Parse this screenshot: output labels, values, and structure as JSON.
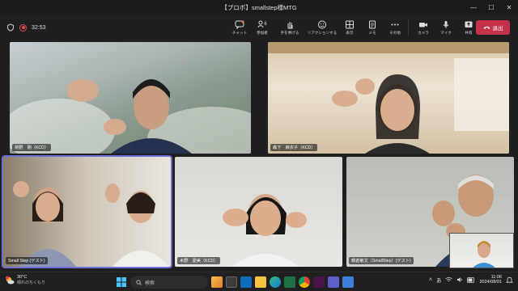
{
  "window": {
    "title": "【プロボ】smallstep様MTG",
    "controls": [
      "minimize",
      "maximize",
      "close"
    ]
  },
  "toolbar": {
    "timer": "32:53",
    "actions": [
      {
        "label": "チャット",
        "icon": "chat-icon"
      },
      {
        "label": "参加者",
        "icon": "people-icon",
        "badge": "6"
      },
      {
        "label": "手を挙げる",
        "icon": "raise-hand-icon"
      },
      {
        "label": "リアクションする",
        "icon": "reaction-icon"
      },
      {
        "label": "表示",
        "icon": "view-icon"
      },
      {
        "label": "メモ",
        "icon": "notes-icon"
      },
      {
        "label": "その他",
        "icon": "more-icon"
      }
    ],
    "devices": [
      {
        "label": "カメラ",
        "icon": "camera-icon"
      },
      {
        "label": "マイク",
        "icon": "mic-icon"
      },
      {
        "label": "共有",
        "icon": "share-icon"
      }
    ],
    "leave_label": "退出"
  },
  "participants": [
    {
      "name": "荷野　剛（KCD）",
      "tile": "t1"
    },
    {
      "name": "森下　麻衣子（KCD）",
      "tile": "t2"
    },
    {
      "name": "Small Step (ゲスト)",
      "tile": "t3"
    },
    {
      "name": "木野　愛美（KCD）",
      "tile": "t4"
    },
    {
      "name": "朝倉敏文（SmallStep）(ゲスト)",
      "tile": "t5"
    }
  ],
  "taskbar": {
    "weather_temp": "30°C",
    "weather_text": "晴れのちくもり",
    "search_placeholder": "検索",
    "time": "11:06",
    "date": "2024/08/01",
    "lang": "あ"
  },
  "colors": {
    "leave": "#c4314b",
    "active_speaker": "#6b6fd6",
    "record": "#e04b4b"
  }
}
